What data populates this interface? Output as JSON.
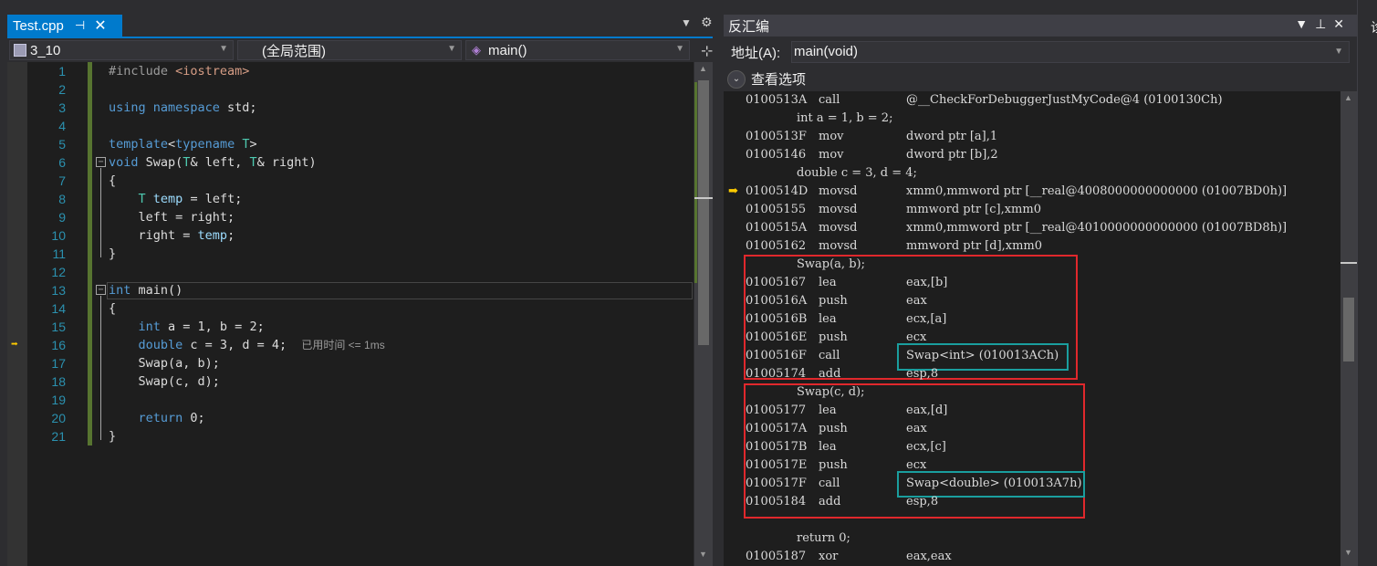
{
  "editor": {
    "tab_title": "Test.cpp",
    "tab_pin_glyph": "⊣",
    "tab_close_glyph": "✕",
    "project_combo": "3_10",
    "scope_combo": "(全局范围)",
    "function_combo": "main()",
    "current_line": 16,
    "elapsed_hint": "已用时间 <= 1ms",
    "lines": [
      {
        "n": "1",
        "html": "<span class='pp'>#include </span><span class='str'>&lt;iostream&gt;</span>"
      },
      {
        "n": "2",
        "html": ""
      },
      {
        "n": "3",
        "html": "<span class='kw'>using namespace</span> std;"
      },
      {
        "n": "4",
        "html": ""
      },
      {
        "n": "5",
        "html": "<span class='kw'>template</span>&lt;<span class='kw'>typename</span> <span class='type'>T</span>&gt;"
      },
      {
        "n": "6",
        "html": "<span class='kw'>void</span> Swap(<span class='type'>T</span>&amp; left, <span class='type'>T</span>&amp; right)"
      },
      {
        "n": "7",
        "html": "{"
      },
      {
        "n": "8",
        "html": "    <span class='type'>T</span> <span class='var'>temp</span> = left;"
      },
      {
        "n": "9",
        "html": "    left = right;"
      },
      {
        "n": "10",
        "html": "    right = <span class='var'>temp</span>;"
      },
      {
        "n": "11",
        "html": "}"
      },
      {
        "n": "12",
        "html": ""
      },
      {
        "n": "13",
        "html": "<span class='kw'>int</span> main()"
      },
      {
        "n": "14",
        "html": "{"
      },
      {
        "n": "15",
        "html": "    <span class='kw'>int</span> a = 1, b = 2;"
      },
      {
        "n": "16",
        "html": "    <span class='kw'>double</span> c = 3, d = 4;  <span class='elapsed'>已用时间 &lt;= 1ms</span>"
      },
      {
        "n": "17",
        "html": "    Swap(a, b);"
      },
      {
        "n": "18",
        "html": "    Swap(c, d);"
      },
      {
        "n": "19",
        "html": ""
      },
      {
        "n": "20",
        "html": "    <span class='kw'>return</span> 0;"
      },
      {
        "n": "21",
        "html": "}"
      }
    ]
  },
  "disassembly": {
    "title": "反汇编",
    "address_label": "地址(A):",
    "address_value": "main(void)",
    "view_options_label": "查看选项",
    "rows": [
      {
        "kind": "asm",
        "addr": "0100513A",
        "op": "call",
        "args": "@__CheckForDebuggerJustMyCode@4 (0100130Ch)"
      },
      {
        "kind": "src",
        "text": "int a = 1, b = 2;"
      },
      {
        "kind": "asm",
        "addr": "0100513F",
        "op": "mov",
        "args": "dword ptr [a],1"
      },
      {
        "kind": "asm",
        "addr": "01005146",
        "op": "mov",
        "args": "dword ptr [b],2"
      },
      {
        "kind": "src",
        "text": "double c = 3, d = 4;"
      },
      {
        "kind": "asm",
        "addr": "0100514D",
        "op": "movsd",
        "args": "xmm0,mmword ptr [__real@4008000000000000 (01007BD0h)]",
        "current": true
      },
      {
        "kind": "asm",
        "addr": "01005155",
        "op": "movsd",
        "args": "mmword ptr [c],xmm0"
      },
      {
        "kind": "asm",
        "addr": "0100515A",
        "op": "movsd",
        "args": "xmm0,mmword ptr [__real@4010000000000000 (01007BD8h)]"
      },
      {
        "kind": "asm",
        "addr": "01005162",
        "op": "movsd",
        "args": "mmword ptr [d],xmm0"
      },
      {
        "kind": "src",
        "text": "Swap(a, b);"
      },
      {
        "kind": "asm",
        "addr": "01005167",
        "op": "lea",
        "args": "eax,[b]"
      },
      {
        "kind": "asm",
        "addr": "0100516A",
        "op": "push",
        "args": "eax"
      },
      {
        "kind": "asm",
        "addr": "0100516B",
        "op": "lea",
        "args": "ecx,[a]"
      },
      {
        "kind": "asm",
        "addr": "0100516E",
        "op": "push",
        "args": "ecx"
      },
      {
        "kind": "asm",
        "addr": "0100516F",
        "op": "call",
        "args": "Swap<int> (010013ACh)"
      },
      {
        "kind": "asm",
        "addr": "01005174",
        "op": "add",
        "args": "esp,8"
      },
      {
        "kind": "src",
        "text": "Swap(c, d);"
      },
      {
        "kind": "asm",
        "addr": "01005177",
        "op": "lea",
        "args": "eax,[d]"
      },
      {
        "kind": "asm",
        "addr": "0100517A",
        "op": "push",
        "args": "eax"
      },
      {
        "kind": "asm",
        "addr": "0100517B",
        "op": "lea",
        "args": "ecx,[c]"
      },
      {
        "kind": "asm",
        "addr": "0100517E",
        "op": "push",
        "args": "ecx"
      },
      {
        "kind": "asm",
        "addr": "0100517F",
        "op": "call",
        "args": "Swap<double> (010013A7h)"
      },
      {
        "kind": "asm",
        "addr": "01005184",
        "op": "add",
        "args": "esp,8"
      },
      {
        "kind": "src",
        "text": ""
      },
      {
        "kind": "src",
        "text": "return 0;"
      },
      {
        "kind": "asm",
        "addr": "01005187",
        "op": "xor",
        "args": "eax,eax"
      }
    ]
  },
  "colors": {
    "accent": "#007acc",
    "highlight_box": "#e0282c",
    "call_box": "#1a9e9e",
    "exec_arrow": "#ffcc00"
  },
  "far_right_panel": {
    "clipped_text": "诊"
  }
}
